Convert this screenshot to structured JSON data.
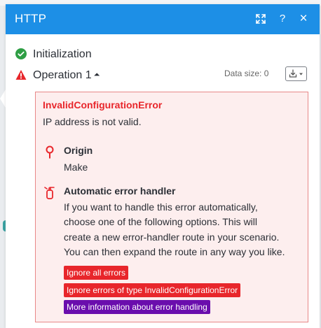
{
  "window": {
    "title": "HTTP",
    "icons": [
      "expand-icon",
      "help-icon",
      "close-icon"
    ],
    "help_label": "?",
    "close_label": "×"
  },
  "rows": {
    "initialization": {
      "label": "Initialization",
      "status": "success"
    },
    "operation": {
      "label": "Operation 1",
      "status": "error",
      "toggle": "⏶"
    }
  },
  "data_size": {
    "label": "Data size: 0"
  },
  "error": {
    "type": "InvalidConfigurationError",
    "message": "IP address is not valid.",
    "origin": {
      "title": "Origin",
      "value": "Make"
    },
    "handler": {
      "title": "Automatic error handler",
      "lines": [
        "If you want to handle this error automatically,",
        "choose one of the following options. This will",
        "create a new error-handler route in your scenario.",
        "You can then expand the route in any way you like."
      ]
    },
    "actions": [
      {
        "label": "Ignore all errors",
        "color": "#e8262b"
      },
      {
        "label": "Ignore errors of type InvalidConfigurationError",
        "color": "#e8262b"
      },
      {
        "label": "More information about error handling",
        "color": "#6a0dad"
      }
    ]
  },
  "colors": {
    "titlebar": "#1d8fe6",
    "success": "#2e9e44",
    "error": "#e8262b",
    "accent_purple": "#6a0dad"
  }
}
